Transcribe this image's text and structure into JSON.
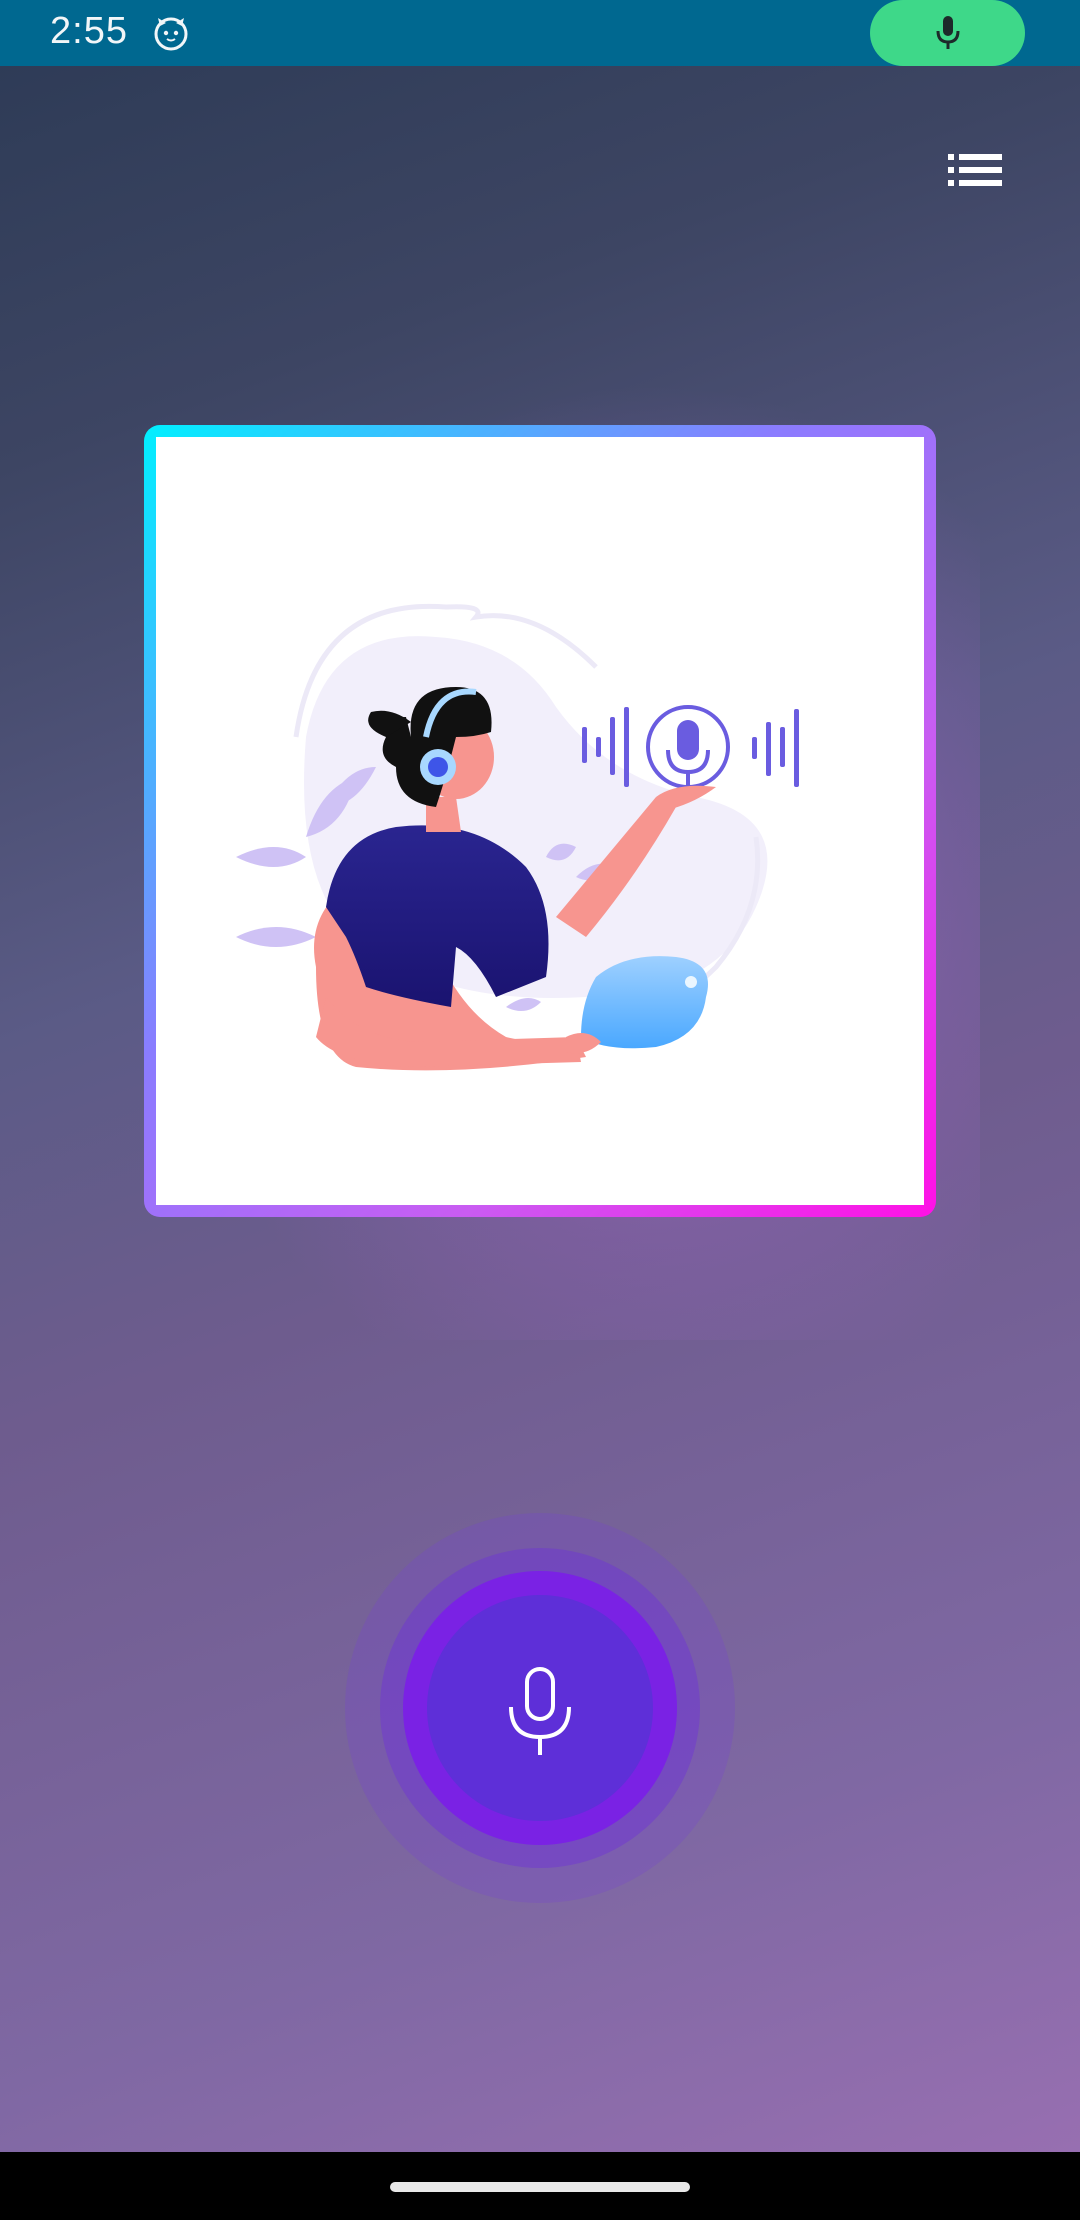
{
  "status_bar": {
    "time": "2:55",
    "app_icon": "cat-face-icon",
    "indicator": {
      "icon": "microphone-icon",
      "color": "#3ed889"
    }
  },
  "toolbar": {
    "menu_icon": "list-icon"
  },
  "illustration": {
    "subject": "voice-assistant-illustration",
    "border_gradient": [
      "#00f0ff",
      "#8a7cff",
      "#ff10e6"
    ]
  },
  "record_button": {
    "icon": "microphone-icon",
    "color": "#5e2fd8"
  },
  "colors": {
    "status_bar_bg": "#006890",
    "background_top": "#2c3a55",
    "background_bottom": "#9b70b3"
  }
}
